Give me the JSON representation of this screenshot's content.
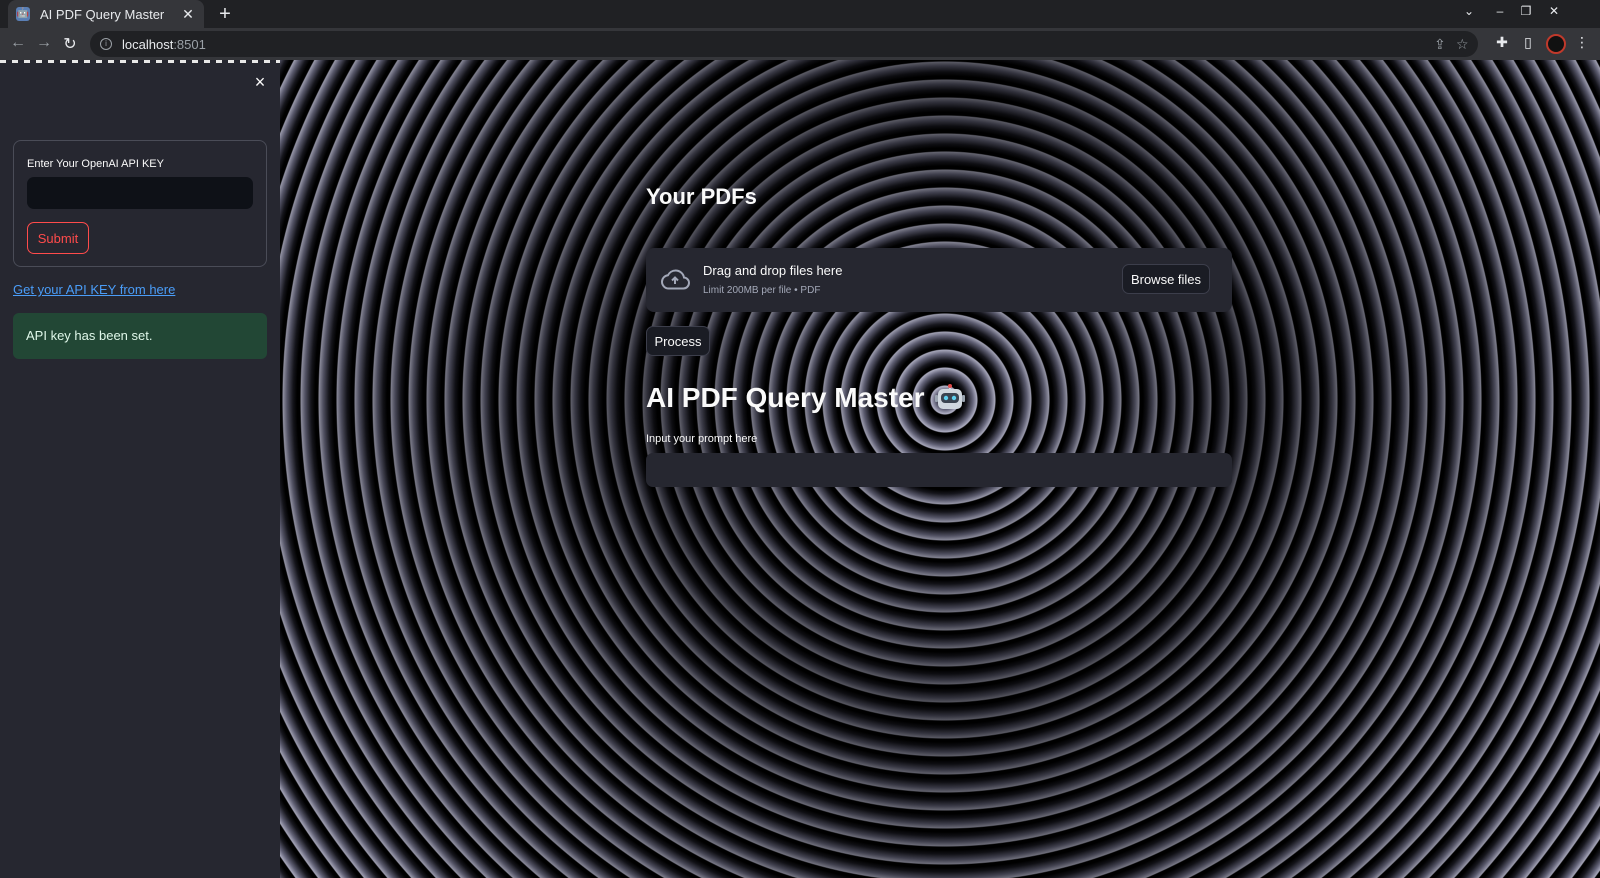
{
  "browser": {
    "tab_title": "AI PDF Query Master",
    "new_tab_symbol": "+",
    "url_host": "localhost",
    "url_port": ":8501"
  },
  "sidebar": {
    "close_symbol": "×",
    "api_key_label": "Enter Your OpenAI API KEY",
    "api_key_value": "",
    "submit_label": "Submit",
    "api_link_text": "Get your API KEY from here",
    "success_message": "API key has been set."
  },
  "main": {
    "pdfs_heading": "Your PDFs",
    "uploader": {
      "title": "Drag and drop files here",
      "subtitle": "Limit 200MB per file • PDF",
      "browse_label": "Browse files"
    },
    "process_label": "Process",
    "app_title": "AI PDF Query Master",
    "prompt_label": "Input your prompt here",
    "prompt_value": ""
  },
  "colors": {
    "accent": "#ff4b4b",
    "link": "#4a9df8",
    "success_bg": "#224735",
    "sidebar_bg": "#262730"
  },
  "icons": [
    "cloud-upload-icon",
    "robot-icon",
    "close-icon",
    "info-icon",
    "share-icon",
    "star-icon",
    "extensions-icon",
    "sidepanel-icon",
    "menu-icon"
  ]
}
